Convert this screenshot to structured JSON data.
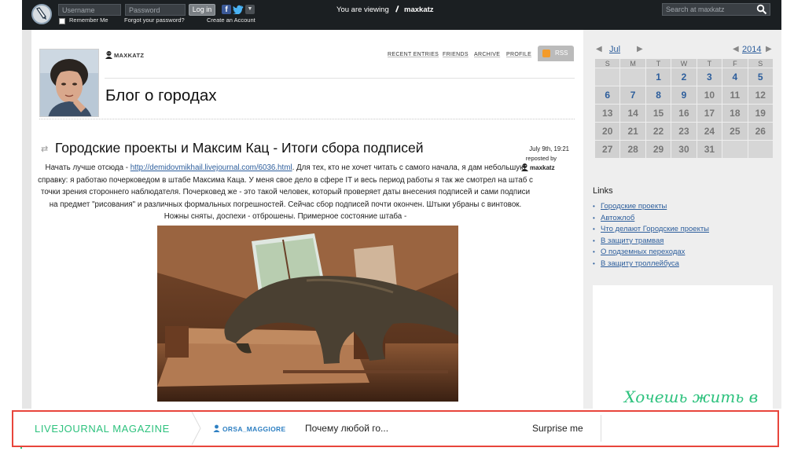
{
  "topbar": {
    "username_placeholder": "Username",
    "password_placeholder": "Password",
    "login_label": "Log in",
    "remember_label": "Remember Me",
    "forgot_label": "Forgot your password?",
    "create_label": "Create an Account",
    "viewing_prefix": "You are viewing",
    "viewing_user": "maxkatz",
    "search_placeholder": "Search at maxkatz"
  },
  "header": {
    "username": "MAXKATZ",
    "nav": [
      "RECENT ENTRIES",
      "FRIENDS",
      "ARCHIVE",
      "PROFILE"
    ],
    "rss_label": "RSS",
    "blog_title": "Блог о городах"
  },
  "entry": {
    "title": "Городские проекты и Максим Кац - Итоги сбора подписей",
    "date": "July 9th, 19:21",
    "reposted_label": "reposted by",
    "reposted_user": "maxkatz",
    "body_lead": "Начать лучше отсюда - ",
    "body_link": "http://demidovmikhail.livejournal.com/6036.html",
    "body_text": ". Для тех, кто не хочет читать с самого начала, я дам небольшую справку: я работаю почерковедом в штабе Максима Каца. У меня свое дело в сфере IT и весь период работы я так же смотрел на штаб с точки зрения стороннего наблюдателя. Почерковед же - это такой человек, который проверяет даты внесения подписей и сами подписи на предмет \"рисования\" и различных формальных погрешностей.  Сейчас сбор подписей почти окончен. Штыки убраны с винтовок. Ножны сняты, доспехи - отброшены. Примерное состояние штаба -"
  },
  "calendar": {
    "prev_month_arrow": "◀",
    "month": "Jul",
    "next_month_arrow": "▶",
    "prev_year_arrow": "◀",
    "year": "2014",
    "next_year_arrow": "▶",
    "weekdays": [
      "S",
      "M",
      "T",
      "W",
      "T",
      "F",
      "S"
    ],
    "weeks": [
      [
        "",
        "",
        "1",
        "2",
        "3",
        "4",
        "5"
      ],
      [
        "6",
        "7",
        "8",
        "9",
        "10",
        "11",
        "12"
      ],
      [
        "13",
        "14",
        "15",
        "16",
        "17",
        "18",
        "19"
      ],
      [
        "20",
        "21",
        "22",
        "23",
        "24",
        "25",
        "26"
      ],
      [
        "27",
        "28",
        "29",
        "30",
        "31",
        "",
        ""
      ]
    ],
    "linked_days": [
      "1",
      "2",
      "3",
      "4",
      "5",
      "6",
      "7",
      "8",
      "9"
    ]
  },
  "sidebar": {
    "links_title": "Links",
    "links": [
      "Городские проекты",
      "Автожлоб",
      "Что делают Городские проекты",
      "В защиту трамвая",
      "О подземных переходах",
      "В защиту троллейбуса"
    ],
    "ad_text": "Хочешь жить в"
  },
  "magazine": {
    "title": "LIVEJOURNAL MAGAZINE",
    "author": "ORSA_MAGGIORE",
    "headline": "Почему любой го...",
    "surprise": "Surprise me"
  },
  "colors": {
    "topbar_bg": "#1b1f22",
    "link_blue": "#2d5e9c",
    "magazine_green": "#2ec27e",
    "highlight_red": "#e8453c",
    "sidebar_bg": "#eeeeee"
  }
}
